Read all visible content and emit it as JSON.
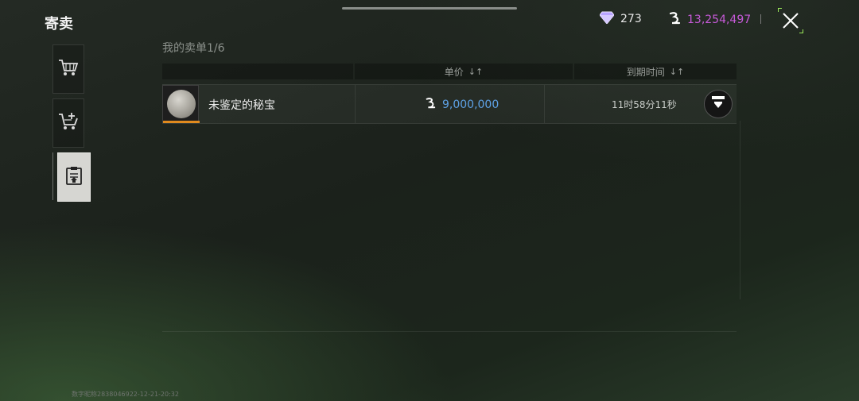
{
  "header": {
    "title": "寄卖",
    "gem": {
      "icon": "diamond-icon",
      "value": "273",
      "color": "#c9b8ff"
    },
    "currency": {
      "icon": "coin-symbol-icon",
      "value": "13,254,497",
      "color": "#c65ad8"
    },
    "close_icon": "close-icon"
  },
  "sidebar": {
    "tabs": [
      {
        "icon": "cart-icon",
        "active": false
      },
      {
        "icon": "cart-add-icon",
        "active": false
      },
      {
        "icon": "clipboard-upload-icon",
        "active": true
      }
    ]
  },
  "list": {
    "title": "我的卖单1/6",
    "columns": [
      {
        "label": "",
        "sortable": false
      },
      {
        "label": "单价",
        "sortable": true,
        "arrow": "↓↑"
      },
      {
        "label": "到期时间",
        "sortable": true,
        "arrow": "↓↑"
      }
    ],
    "rows": [
      {
        "thumb_icon": "silver-coin-icon",
        "name": "未鉴定的秘宝",
        "price": "9,000,000",
        "price_color": "#5ea2e6",
        "expire": "11时58分11秒",
        "action_icon": "takedown-icon"
      }
    ]
  },
  "watermark": "数字昵称2838046922-12-21-20:32"
}
